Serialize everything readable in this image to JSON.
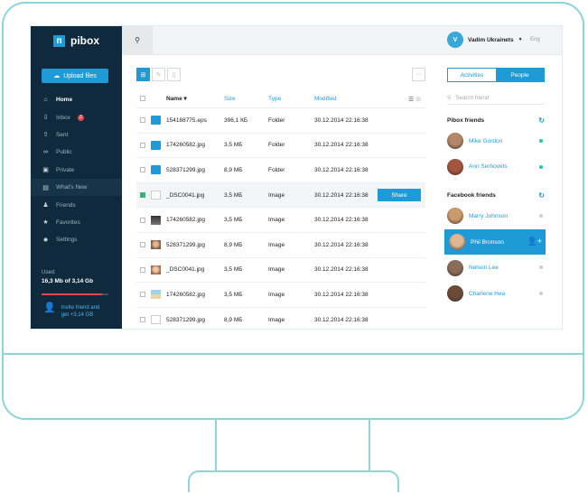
{
  "app": {
    "name": "pibox"
  },
  "sidebar": {
    "upload_label": "Upload files",
    "items": [
      {
        "label": "Home",
        "icon": "home-icon",
        "glyph": "⌂"
      },
      {
        "label": "Inbox",
        "icon": "inbox-icon",
        "glyph": "⇩",
        "badge": "2"
      },
      {
        "label": "Sent",
        "icon": "sent-icon",
        "glyph": "⇧"
      },
      {
        "label": "Public",
        "icon": "link-icon",
        "glyph": "∞"
      },
      {
        "label": "Private",
        "icon": "lock-icon",
        "glyph": "▣"
      },
      {
        "label": "What's New",
        "icon": "document-icon",
        "glyph": "▤"
      },
      {
        "label": "Friends",
        "icon": "friends-icon",
        "glyph": "♟"
      },
      {
        "label": "Favorites",
        "icon": "star-icon",
        "glyph": "★"
      },
      {
        "label": "Settings",
        "icon": "gear-icon",
        "glyph": "✹"
      }
    ],
    "usage_label": "Used:",
    "usage_value": "16,3 Mb of 3,14 Gb",
    "usage_fraction": 0.9,
    "invite_line1": "Invite friend and",
    "invite_line2": "get +3,14 GB"
  },
  "header": {
    "user_name": "Vadim Ukrainets",
    "language": "Eng"
  },
  "table": {
    "columns": {
      "name": "Name ▾",
      "size": "Size",
      "type": "Type",
      "modified": "Modified"
    },
    "share_label": "Share",
    "rows": [
      {
        "name": "154188775.eps",
        "size": "396,1 КБ",
        "type": "Folder",
        "modified": "30.12.2014 22:16:38",
        "thumb": "folder",
        "checked": false
      },
      {
        "name": "174260582.jpg",
        "size": "3,5 МБ",
        "type": "Folder",
        "modified": "30.12.2014 22:16:38",
        "thumb": "folder",
        "checked": false
      },
      {
        "name": "528371299.jpg",
        "size": "8,9 МБ",
        "type": "Folder",
        "modified": "30.12.2014 22:16:38",
        "thumb": "folder",
        "checked": false
      },
      {
        "name": "_DSC0041.jpg",
        "size": "3,5 МБ",
        "type": "Image",
        "modified": "30.12.2014 22:16:38",
        "thumb": "doc",
        "checked": true
      },
      {
        "name": "174260582.jpg",
        "size": "3,5 МБ",
        "type": "Image",
        "modified": "30.12.2014 22:16:38",
        "thumb": "photo-dark",
        "checked": false
      },
      {
        "name": "528371299.jpg",
        "size": "8,9 МБ",
        "type": "Image",
        "modified": "30.12.2014 22:16:38",
        "thumb": "photo-face",
        "checked": false
      },
      {
        "name": "_DSC0041.jpg",
        "size": "3,5 МБ",
        "type": "Image",
        "modified": "30.12.2014 22:16:38",
        "thumb": "photo-face2",
        "checked": false
      },
      {
        "name": "174260582.jpg",
        "size": "3,5 МБ",
        "type": "Image",
        "modified": "30.12.2014 22:16:38",
        "thumb": "photo-beach",
        "checked": false
      },
      {
        "name": "528371299.jpg",
        "size": "8,9 МБ",
        "type": "Image",
        "modified": "30.12.2014 22:16:38",
        "thumb": "doc",
        "checked": false
      }
    ]
  },
  "right_panel": {
    "tab_activities": "Activities",
    "tab_people": "People",
    "search_placeholder": "Search friend",
    "pibox_friends_title": "Pibox friends",
    "facebook_friends_title": "Facebook friends",
    "pibox_friends": [
      {
        "name": "Mike Gordon",
        "status": "online",
        "color": "#b5876a"
      },
      {
        "name": "Ann Serhovets",
        "status": "online",
        "color": "#a4553f"
      }
    ],
    "facebook_friends": [
      {
        "name": "Marry Johnson",
        "status": "offline",
        "color": "#c99a6c"
      },
      {
        "name": "Phil Bronson",
        "status": "selected",
        "color": "#e0b792"
      },
      {
        "name": "Nelson Lee",
        "status": "offline",
        "color": "#8a6c5a"
      },
      {
        "name": "Charlene Hea",
        "status": "offline",
        "color": "#6c4a3a"
      }
    ]
  },
  "colors": {
    "accent": "#1e9bd7",
    "sidebar": "#0f2a3c",
    "online": "#2ec4a6",
    "alert": "#e5484d"
  }
}
